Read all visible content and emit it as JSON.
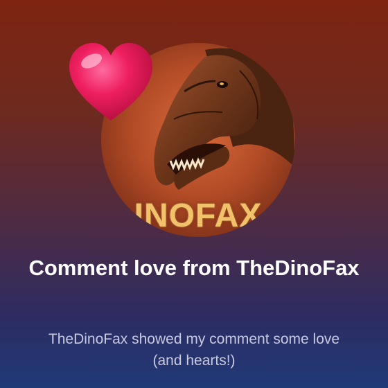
{
  "card": {
    "title": "Comment love from TheDinoFax",
    "subtitle": "TheDinoFax showed my comment some love (and hearts!)"
  },
  "avatar": {
    "logo_text": "INOFAX",
    "description_icon": "dinosaur-icon"
  },
  "icons": {
    "heart": "heart-icon"
  },
  "colors": {
    "heart": "#e8195c",
    "title": "#ffffff",
    "subtitle": "#c9c9df",
    "logo_text": "#f1c26a"
  }
}
